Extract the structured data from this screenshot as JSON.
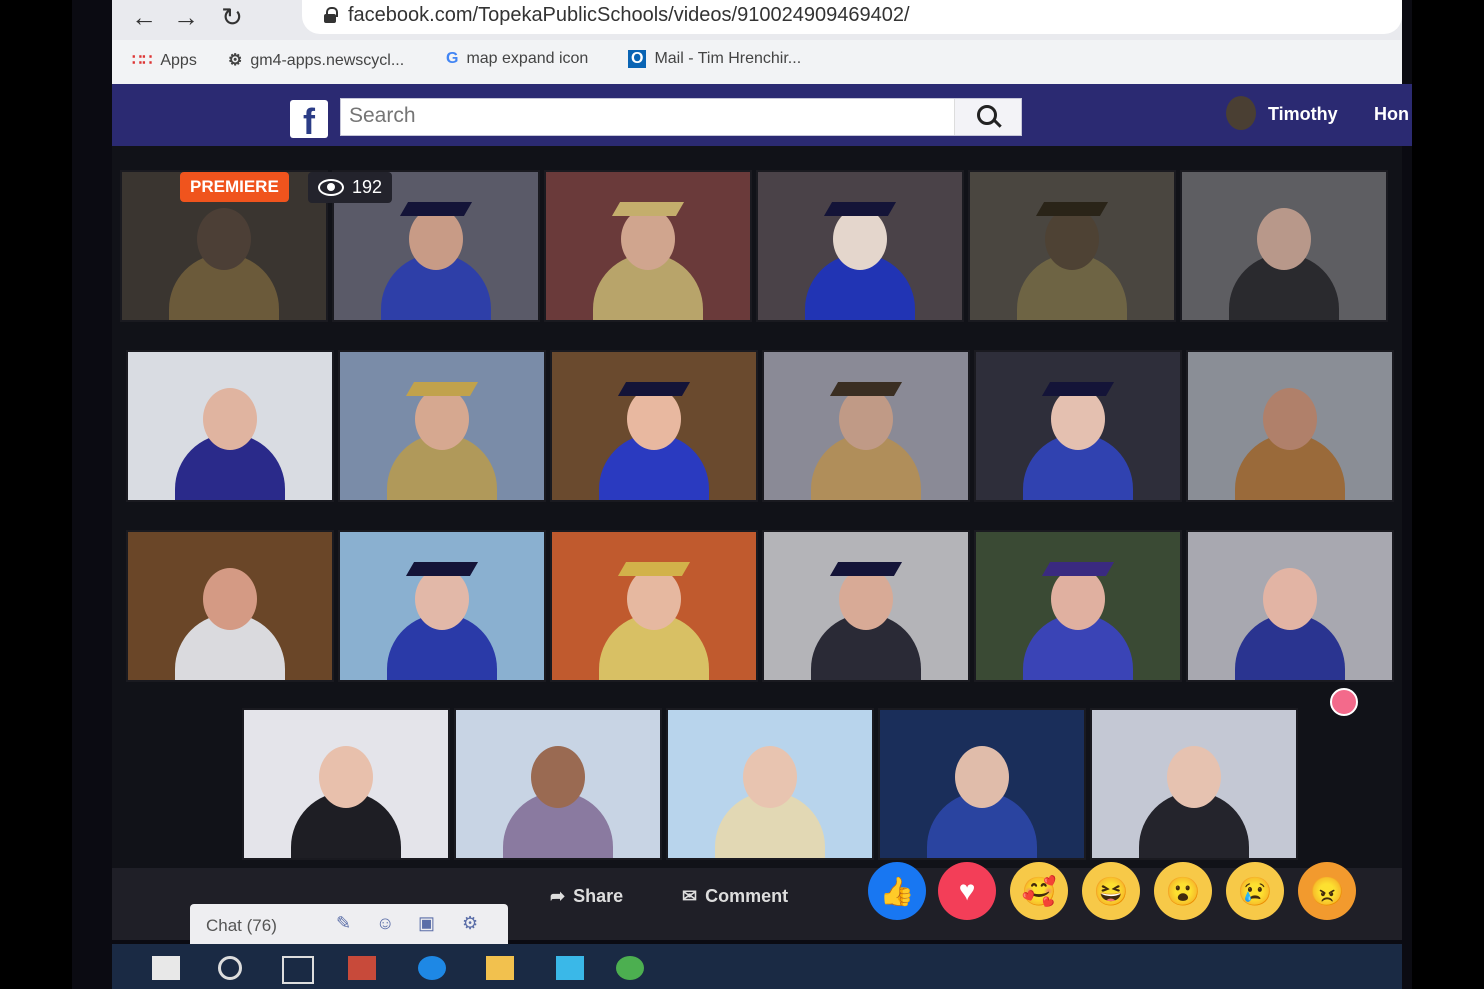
{
  "browser": {
    "url": "facebook.com/TopekaPublicSchools/videos/910024909469402/",
    "back_icon": "arrow-left-icon",
    "forward_icon": "arrow-right-icon",
    "reload_icon": "reload-icon",
    "bookmarks": [
      {
        "label": "Apps",
        "icon": "grid-icon"
      },
      {
        "label": "gm4-apps.newscycl...",
        "icon": "gear-icon"
      },
      {
        "label": "map expand icon",
        "icon": "google-icon"
      },
      {
        "label": "Mail - Tim Hrenchir...",
        "icon": "outlook-icon"
      }
    ]
  },
  "facebook": {
    "logo": "f",
    "search_placeholder": "Search",
    "user_name": "Timothy",
    "home_label": "Hon"
  },
  "video": {
    "premiere_label": "PREMIERE",
    "viewer_count": "192"
  },
  "actions": {
    "share_label": "Share",
    "comment_label": "Comment",
    "reactions": [
      "like",
      "love",
      "care",
      "haha",
      "wow",
      "sad",
      "angry"
    ]
  },
  "chat": {
    "label": "Chat (76)"
  },
  "colors": {
    "fb_bar": "#2b2a72",
    "premiere": "#f0541d",
    "like": "#1877f2",
    "love": "#f33e58"
  }
}
